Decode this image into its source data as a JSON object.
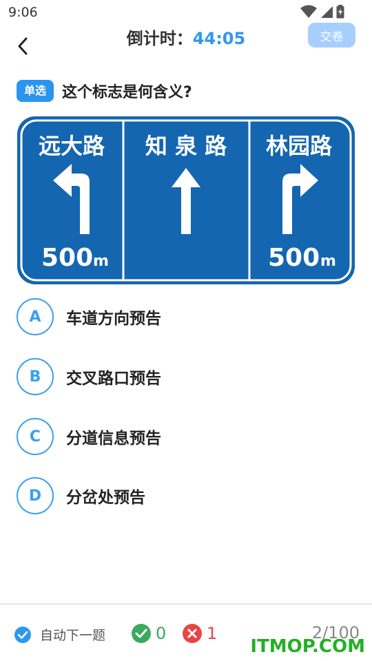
{
  "status_bar": {
    "time": "9:06"
  },
  "header": {
    "timer_label": "倒计时：",
    "timer_value": "44:05",
    "submit_label": "交卷"
  },
  "question": {
    "type": "单选",
    "text": "这个标志是何含义?"
  },
  "sign": {
    "panels": [
      {
        "name": "远大路",
        "distance": "500",
        "unit": "m",
        "arrow": "left-turn-arrow"
      },
      {
        "name": "知 泉 路",
        "distance": "",
        "unit": "",
        "arrow": "straight-arrow"
      },
      {
        "name": "林园路",
        "distance": "500",
        "unit": "m",
        "arrow": "right-turn-arrow"
      }
    ],
    "colors": {
      "background": "#1466b0",
      "border": "#ffffff"
    }
  },
  "options": [
    {
      "key": "A",
      "text": "车道方向预告"
    },
    {
      "key": "B",
      "text": "交叉路口预告"
    },
    {
      "key": "C",
      "text": "分道信息预告"
    },
    {
      "key": "D",
      "text": "分岔处预告"
    }
  ],
  "bottom": {
    "auto_next": "自动下一题",
    "correct_count": "0",
    "wrong_count": "1",
    "progress": "2/100",
    "watermark": "ITMOP.COM"
  },
  "colors": {
    "accent": "#2d98f0",
    "correct": "#3aaa5c",
    "wrong": "#e84545"
  }
}
